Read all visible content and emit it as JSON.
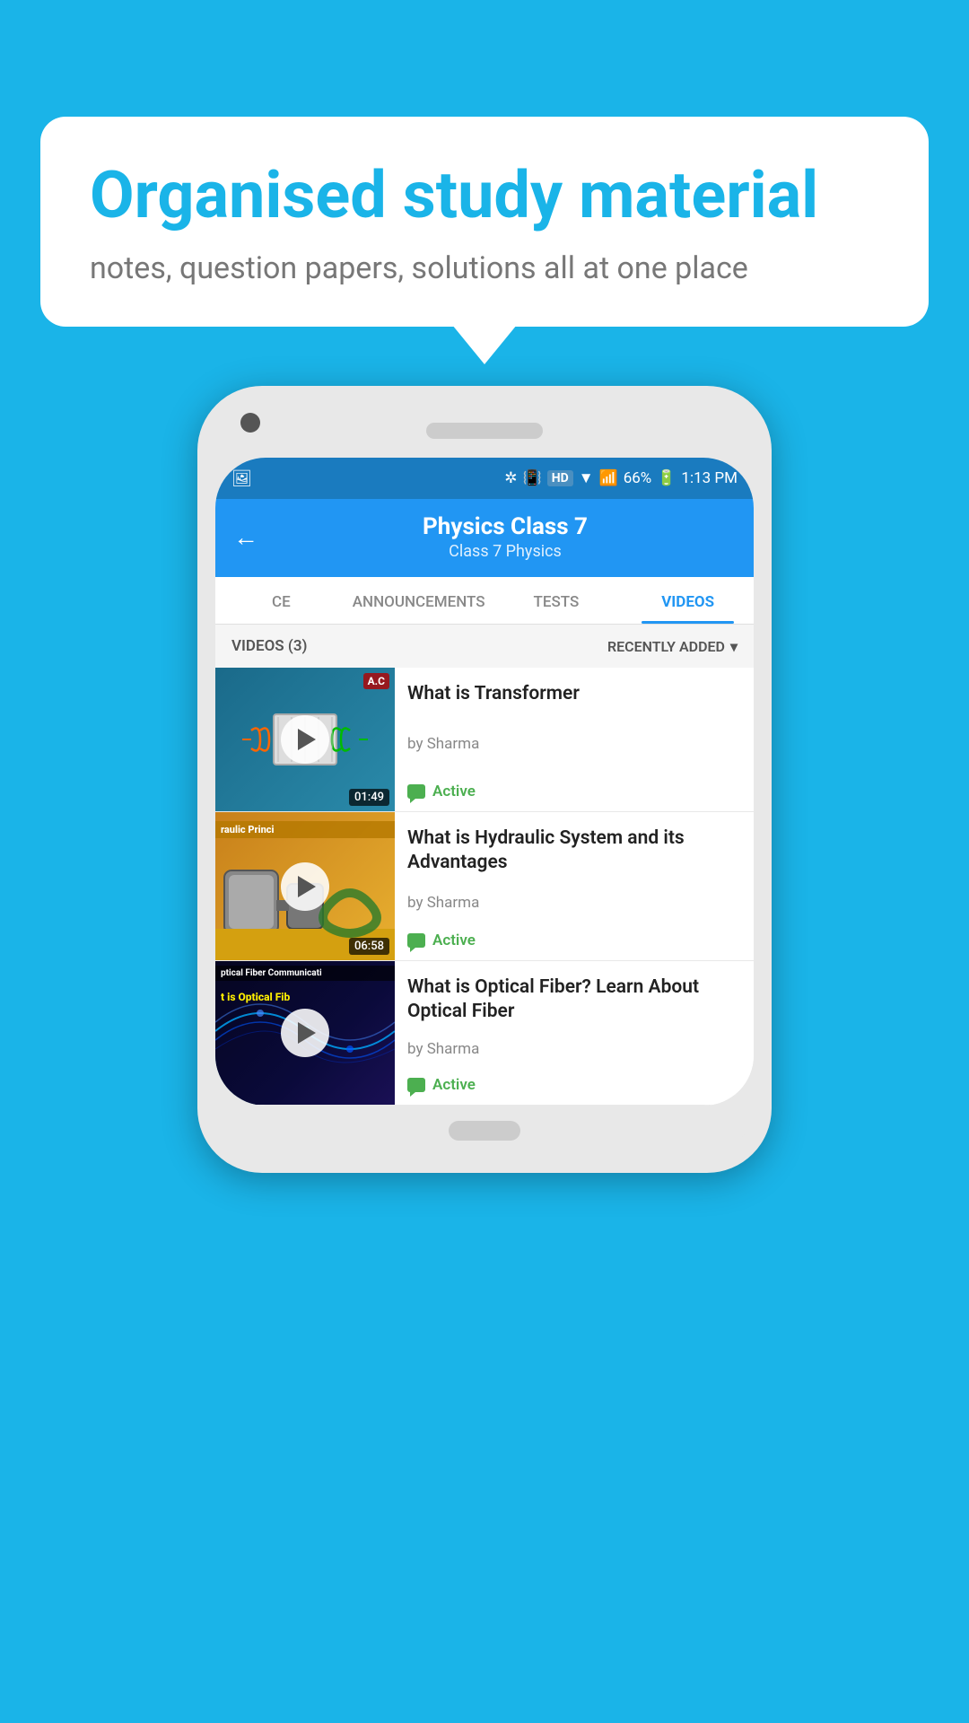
{
  "background_color": "#1ab4e8",
  "speech_bubble": {
    "title": "Organised study material",
    "subtitle": "notes, question papers, solutions all at one place"
  },
  "status_bar": {
    "time": "1:13 PM",
    "battery": "66%",
    "signal": "HD"
  },
  "app_header": {
    "title": "Physics Class 7",
    "breadcrumb": "Class 7    Physics",
    "back_label": "←"
  },
  "tabs": [
    {
      "label": "CE",
      "active": false
    },
    {
      "label": "ANNOUNCEMENTS",
      "active": false
    },
    {
      "label": "TESTS",
      "active": false
    },
    {
      "label": "VIDEOS",
      "active": true
    }
  ],
  "list_header": {
    "count_label": "VIDEOS (3)",
    "sort_label": "RECENTLY ADDED"
  },
  "videos": [
    {
      "title": "What is  Transformer",
      "author": "by Sharma",
      "status": "Active",
      "duration": "01:49",
      "thumb_type": "transformer"
    },
    {
      "title": "What is Hydraulic System and its Advantages",
      "author": "by Sharma",
      "status": "Active",
      "duration": "06:58",
      "thumb_type": "hydraulic",
      "thumb_text1": "raulic Princi",
      "thumb_text2": ""
    },
    {
      "title": "What is Optical Fiber? Learn About Optical Fiber",
      "author": "by Sharma",
      "status": "Active",
      "duration": "",
      "thumb_type": "optical",
      "thumb_text1": "ptical Fiber Communicati",
      "thumb_text2": "t is Optical Fib"
    }
  ]
}
